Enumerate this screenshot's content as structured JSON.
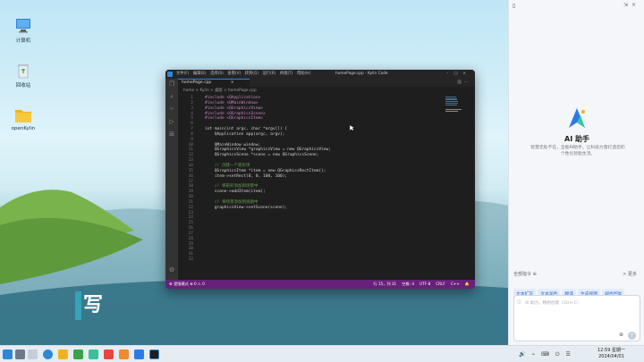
{
  "desktop": {
    "icons": [
      {
        "label": "计算机",
        "icon": "computer-icon"
      },
      {
        "label": "回收站",
        "icon": "trash-icon"
      },
      {
        "label": "openKylin",
        "icon": "folder-icon"
      }
    ]
  },
  "editor": {
    "menu": [
      "文件(F)",
      "编辑(E)",
      "选择(S)",
      "查看(V)",
      "转到(G)",
      "运行(R)",
      "终端(T)",
      "帮助(H)"
    ],
    "window_title": "homePage.cpp - Kylin Code",
    "tab_label": "homePage.cpp",
    "breadcrumb": "home > Kylin > 桌面 > homePage.cpp",
    "lines": [
      {
        "n": "1",
        "t": "#include <QApplication>",
        "c": "#c586c0"
      },
      {
        "n": "2",
        "t": "#include <QMainWindow>",
        "c": "#c586c0"
      },
      {
        "n": "3",
        "t": "#include <QGraphicsView>",
        "c": "#c586c0"
      },
      {
        "n": "4",
        "t": "#include <QGraphicsScene>",
        "c": "#c586c0"
      },
      {
        "n": "5",
        "t": "#include <QGraphicsItem>",
        "c": "#c586c0"
      },
      {
        "n": "6",
        "t": "",
        "c": "#d4d4d4"
      },
      {
        "n": "7",
        "t": "int main(int argc, char *argv[]) {",
        "c": "#d4d4d4"
      },
      {
        "n": "8",
        "t": "    QApplication app(argc, argv);",
        "c": "#d4d4d4"
      },
      {
        "n": "9",
        "t": "",
        "c": "#d4d4d4"
      },
      {
        "n": "10",
        "t": "    QMainWindow window;",
        "c": "#d4d4d4"
      },
      {
        "n": "11",
        "t": "    QGraphicsView *graphicsView = new QGraphicsView;",
        "c": "#d4d4d4"
      },
      {
        "n": "12",
        "t": "    QGraphicsScene *scene = new QGraphicsScene;",
        "c": "#d4d4d4"
      },
      {
        "n": "13",
        "t": "",
        "c": "#d4d4d4"
      },
      {
        "n": "14",
        "t": "    // 创建一个矩形项",
        "c": "#6a9955"
      },
      {
        "n": "15",
        "t": "    QGraphicsItem *item = new QGraphicsRectItem();",
        "c": "#d4d4d4"
      },
      {
        "n": "16",
        "t": "    item->setRect(0, 0, 100, 100);",
        "c": "#d4d4d4"
      },
      {
        "n": "17",
        "t": "",
        "c": "#d4d4d4"
      },
      {
        "n": "18",
        "t": "    // 将矩形添加到场景中",
        "c": "#6a9955"
      },
      {
        "n": "19",
        "t": "    scene->addItem(item);",
        "c": "#d4d4d4"
      },
      {
        "n": "20",
        "t": "",
        "c": "#d4d4d4"
      },
      {
        "n": "21",
        "t": "    // 将场景添加到视图中",
        "c": "#6a9955"
      },
      {
        "n": "22",
        "t": "    graphicsView->setScene(scene);",
        "c": "#d4d4d4"
      },
      {
        "n": "23",
        "t": "",
        "c": "#d4d4d4"
      },
      {
        "n": "24",
        "t": "",
        "c": "#d4d4d4"
      },
      {
        "n": "25",
        "t": "",
        "c": "#d4d4d4"
      },
      {
        "n": "26",
        "t": "",
        "c": "#d4d4d4"
      },
      {
        "n": "27",
        "t": "",
        "c": "#d4d4d4"
      },
      {
        "n": "28",
        "t": "",
        "c": "#d4d4d4"
      },
      {
        "n": "29",
        "t": "",
        "c": "#d4d4d4"
      },
      {
        "n": "30",
        "t": "",
        "c": "#d4d4d4"
      },
      {
        "n": "31",
        "t": "",
        "c": "#d4d4d4"
      },
      {
        "n": "32",
        "t": "",
        "c": "#d4d4d4"
      }
    ],
    "status_left": "⚙ 受限模式   ⊗ 0 ⚠ 0",
    "status_items": [
      "行 15，列 31",
      "空格: 4",
      "UTF-8",
      "CRLF",
      "C++"
    ]
  },
  "ime": {
    "char": "写"
  },
  "assistant": {
    "title": "AI 助手",
    "desc": "智慧无处不在，全能AI助手，让科技力量打造您的个性化智能生活。",
    "commands_label": "全部指令 ⊕",
    "more": "> 更多",
    "chips": [
      "文本扩写",
      "文本润色",
      "翻译",
      "生成视图",
      "邮件回复"
    ],
    "input_placeholder": "AI 助力，畅想创意（Ctrl+C）"
  },
  "taskbar": {
    "date": "2024/04/01",
    "time": "12:59 星期一"
  },
  "colors": {
    "accent": "#2f88d6",
    "statusbar": "#68217a"
  }
}
